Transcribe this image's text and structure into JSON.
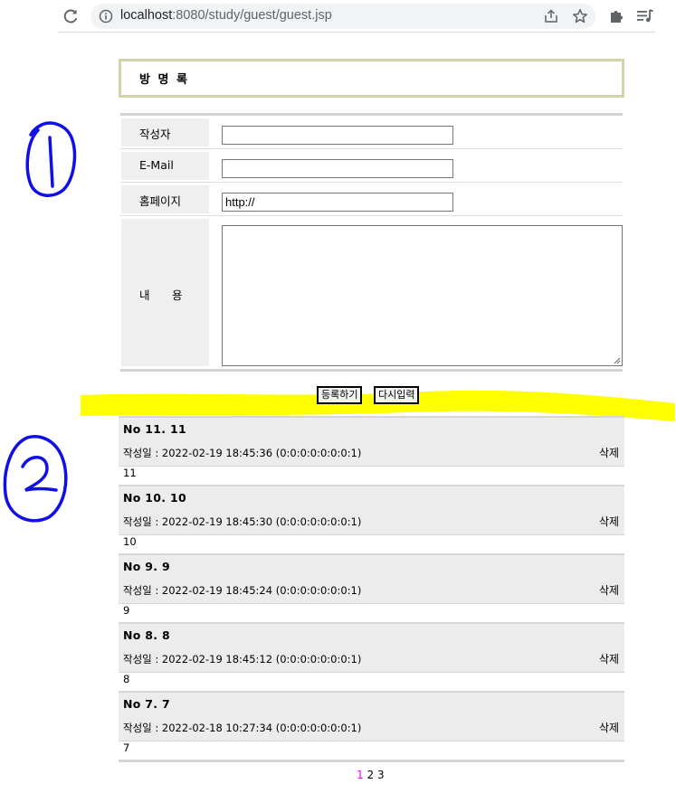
{
  "browser": {
    "url_host": "localhost",
    "url_rest": ":8080/study/guest/guest.jsp"
  },
  "page": {
    "title": "방 명 록"
  },
  "form": {
    "author_label": "작성자",
    "author_value": "",
    "email_label": "E-Mail",
    "email_value": "",
    "homepage_label": "홈페이지",
    "homepage_value": "http://",
    "content_label_1": "내",
    "content_label_2": "용",
    "content_value": "",
    "submit_label": "등록하기",
    "reset_label": "다시입력"
  },
  "annotations": {
    "marker_1": "1",
    "marker_2": "2",
    "highlight_color": "#ffff00",
    "marker_color": "#0000ff"
  },
  "entries": [
    {
      "no": "No 11. 11",
      "meta": "작성일 : 2022-02-19 18:45:36 (0:0:0:0:0:0:0:1)",
      "delete": "삭제",
      "content": "11"
    },
    {
      "no": "No 10. 10",
      "meta": "작성일 : 2022-02-19 18:45:30 (0:0:0:0:0:0:0:1)",
      "delete": "삭제",
      "content": "10"
    },
    {
      "no": "No 9. 9",
      "meta": "작성일 : 2022-02-19 18:45:24 (0:0:0:0:0:0:0:1)",
      "delete": "삭제",
      "content": "9"
    },
    {
      "no": "No 8. 8",
      "meta": "작성일 : 2022-02-19 18:45:12 (0:0:0:0:0:0:0:1)",
      "delete": "삭제",
      "content": "8"
    },
    {
      "no": "No 7. 7",
      "meta": "작성일 : 2022-02-18 10:27:34 (0:0:0:0:0:0:0:1)",
      "delete": "삭제",
      "content": "7"
    }
  ],
  "pagination": {
    "pages": [
      "1",
      "2",
      "3"
    ],
    "current": "1",
    "current_color": "#ff00ff"
  }
}
